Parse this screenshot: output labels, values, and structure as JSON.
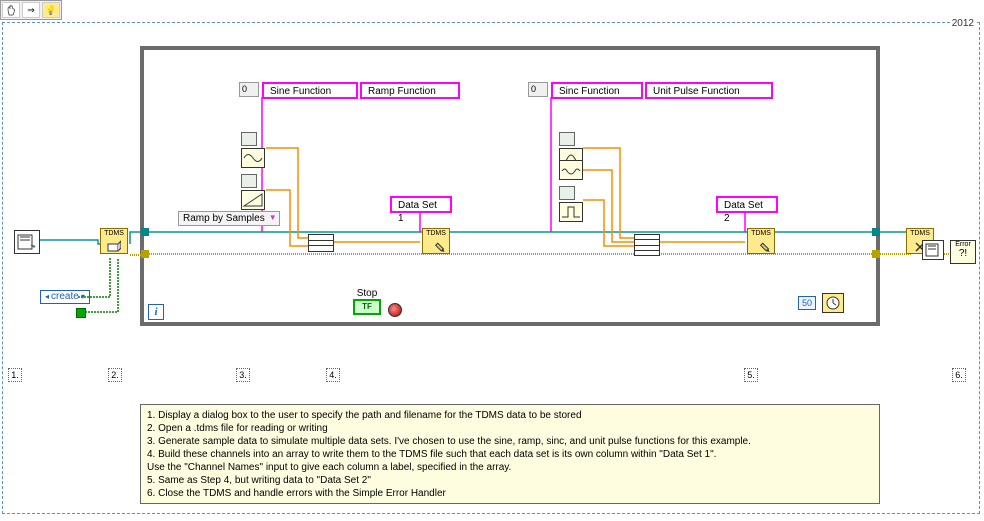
{
  "year": "2012",
  "toolbar": {
    "pan": "hand-icon",
    "arrow": "arrow-icon",
    "highlight": "highlight-icon"
  },
  "array1": {
    "index": "0",
    "ch1": "Sine Function",
    "ch2": "Ramp Function"
  },
  "array2": {
    "index": "0",
    "ch1": "Sinc Function",
    "ch2": "Unit Pulse Function"
  },
  "data_set_1": "Data Set 1",
  "data_set_2": "Data Set 2",
  "ramp_combo": "Ramp by Samples",
  "create_label": "create",
  "stop_label": "Stop",
  "stop_btn": "TF",
  "wait_ms": "50",
  "iter": "i",
  "steps": {
    "s1": "1.",
    "s2": "2.",
    "s3": "3.",
    "s4": "4.",
    "s5": "5.",
    "s6": "6."
  },
  "notes": {
    "l1": "1. Display a dialog box to the user to specify the path and filename for the TDMS data to be stored",
    "l2": "2. Open a .tdms file for reading or writing",
    "l3": "3. Generate sample data to simulate multiple data sets. I've chosen to use the sine, ramp, sinc, and unit pulse functions for this example.",
    "l4": "4. Build these channels into an array to write them to the TDMS file such that each data set is its own column within \"Data Set 1\".",
    "l4b": "    Use the \"Channel Names\" input to give each column a label, specified in the array.",
    "l5": "5. Same as Step 4, but writing data to \"Data Set 2\"",
    "l6": "6. Close the TDMS and handle errors with the Simple Error Handler"
  },
  "tdms_label": "TDMS",
  "error_label": "Error"
}
